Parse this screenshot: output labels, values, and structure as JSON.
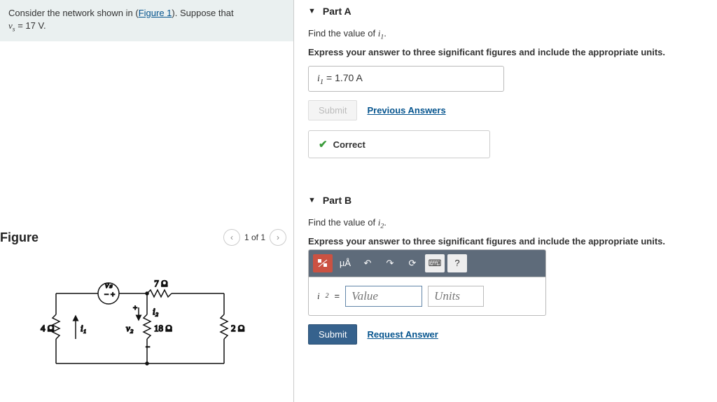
{
  "prompt": {
    "pre": "Consider the network shown in (",
    "link": "Figure 1",
    "post": "). Suppose that ",
    "var": "v",
    "varsub": "s",
    "eq": " = 17 ",
    "unit": "V",
    "tail": "."
  },
  "figure": {
    "title": "Figure",
    "pager": "1 of 1",
    "labels": {
      "vs": "vₛ",
      "r1": "4 Ω",
      "i1": "i₁",
      "r2": "7 Ω",
      "i2": "i₂",
      "v2": "v₂",
      "r3": "18 Ω",
      "r4": "2 Ω"
    }
  },
  "part_a": {
    "title": "Part A",
    "instr1_pre": "Find the value of ",
    "instr1_var": "i",
    "instr1_sub": "1",
    "instr1_post": ".",
    "instr2": "Express your answer to three significant figures and include the appropriate units.",
    "ans_var": "i",
    "ans_sub": "1",
    "ans_eq": " = 1.70 ",
    "ans_unit": "A",
    "submit": "Submit",
    "prev": "Previous Answers",
    "correct": "Correct"
  },
  "part_b": {
    "title": "Part B",
    "instr1_pre": "Find the value of ",
    "instr1_var": "i",
    "instr1_sub": "2",
    "instr1_post": ".",
    "instr2": "Express your answer to three significant figures and include the appropriate units.",
    "toolbar": {
      "ua": "µÅ",
      "q": "?"
    },
    "lhs_var": "i",
    "lhs_sub": "2",
    "lhs_eq": " =",
    "value_ph": "Value",
    "units_ph": "Units",
    "submit": "Submit",
    "req": "Request Answer"
  }
}
